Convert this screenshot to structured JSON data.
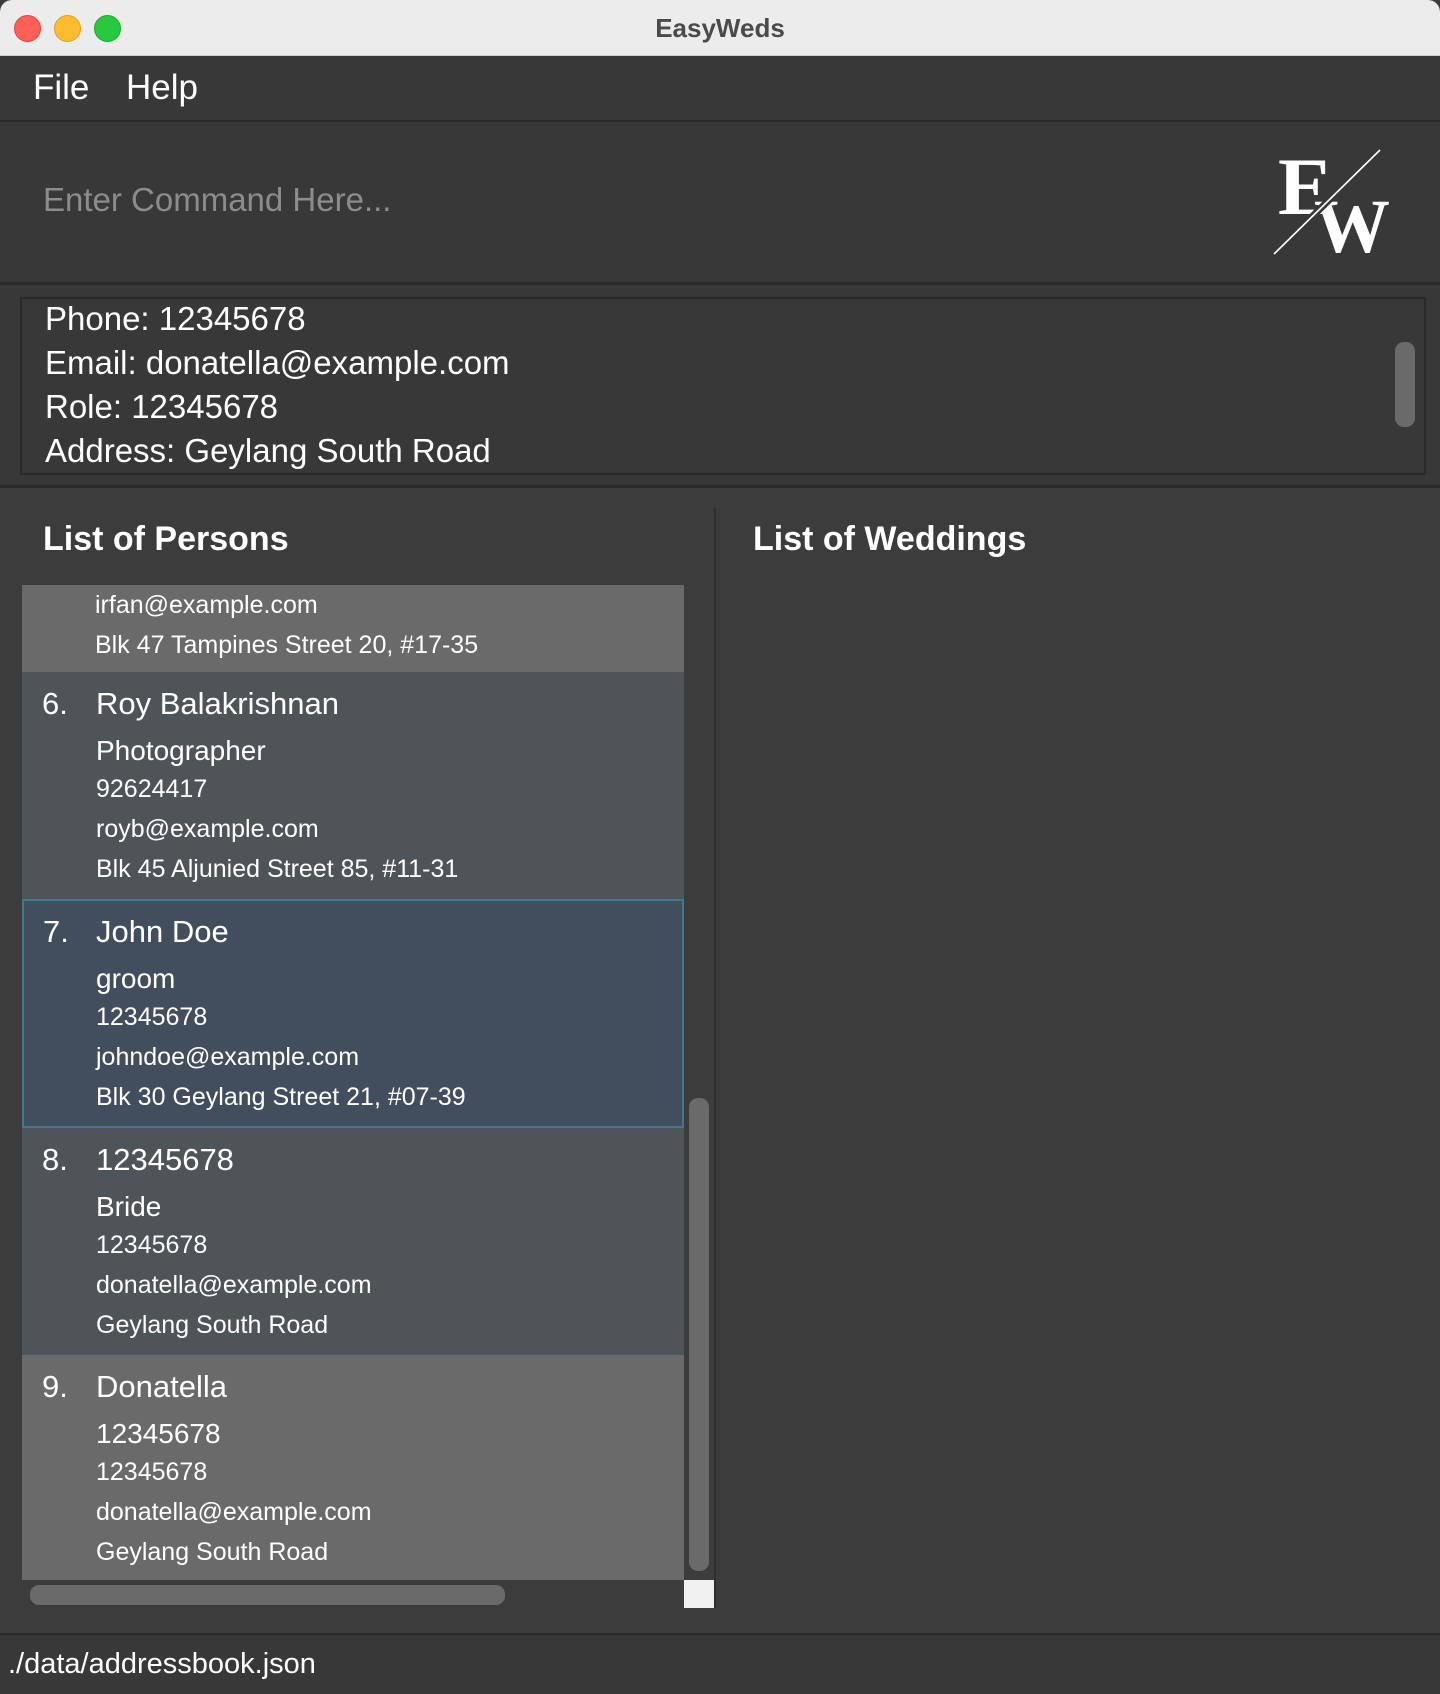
{
  "window": {
    "title": "EasyWeds"
  },
  "menu": {
    "file": "File",
    "help": "Help"
  },
  "command": {
    "placeholder": "Enter Command Here..."
  },
  "logo": {
    "text": "EW"
  },
  "result": {
    "lines": [
      "Phone: 12345678",
      "Email: donatella@example.com",
      "Role: 12345678",
      "Address: Geylang South Road"
    ]
  },
  "persons_panel": {
    "title": "List of Persons",
    "partial_card": {
      "email": "irfan@example.com",
      "address": "Blk 47 Tampines Street 20, #17-35"
    },
    "cards": [
      {
        "index": "6.",
        "name": "Roy Balakrishnan",
        "role": "Photographer",
        "phone": "92624417",
        "email": "royb@example.com",
        "address": "Blk 45 Aljunied Street 85, #11-31"
      },
      {
        "index": "7.",
        "name": "John Doe",
        "role": "groom",
        "phone": "12345678",
        "email": "johndoe@example.com",
        "address": "Blk 30 Geylang Street 21, #07-39"
      },
      {
        "index": "8.",
        "name": "12345678",
        "role": "Bride",
        "phone": "12345678",
        "email": "donatella@example.com",
        "address": "Geylang South Road"
      },
      {
        "index": "9.",
        "name": "Donatella",
        "role": "12345678",
        "phone": "12345678",
        "email": "donatella@example.com",
        "address": "Geylang South Road"
      }
    ]
  },
  "weddings_panel": {
    "title": "List of Weddings"
  },
  "status": {
    "file_path": "./data/addressbook.json"
  }
}
